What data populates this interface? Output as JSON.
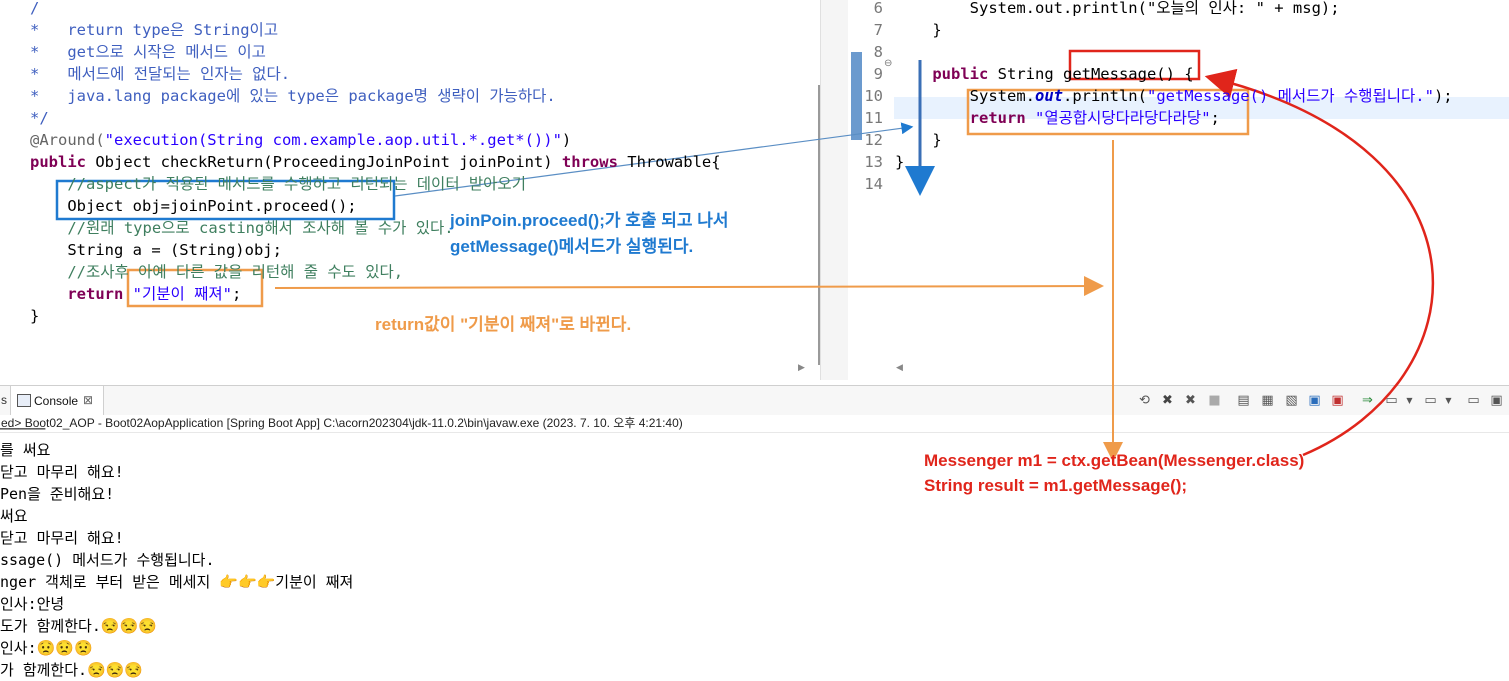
{
  "left_code": {
    "lines": [
      {
        "parts": [
          {
            "t": "/",
            "c": "jd"
          }
        ]
      },
      {
        "parts": [
          {
            "t": "*   return type은 String이고",
            "c": "jd"
          }
        ]
      },
      {
        "parts": [
          {
            "t": "*   get으로 시작은 메서드 이고",
            "c": "jd"
          }
        ]
      },
      {
        "parts": [
          {
            "t": "*   메서드에 전달되는 인자는 없다.",
            "c": "jd"
          }
        ]
      },
      {
        "parts": [
          {
            "t": "*   java.lang package에 있는 type은 package명 생략이 가능하다.",
            "c": "jd"
          }
        ]
      },
      {
        "parts": [
          {
            "t": "*/",
            "c": "jd"
          }
        ]
      },
      {
        "parts": [
          {
            "t": "@Around(",
            "c": "an"
          },
          {
            "t": "\"execution(String com.example.aop.util.*.get*())\"",
            "c": "st"
          },
          {
            "t": ")",
            "c": ""
          }
        ]
      },
      {
        "parts": [
          {
            "t": "public",
            "c": "kw"
          },
          {
            "t": " Object checkReturn(ProceedingJoinPoint joinPoint) ",
            "c": ""
          },
          {
            "t": "throws",
            "c": "kw"
          },
          {
            "t": " Throwable{",
            "c": ""
          }
        ]
      },
      {
        "parts": [
          {
            "t": "    //aspect가 적용된 메서드를 수행하고 리턴되는 데이터 받아오기",
            "c": "cm"
          }
        ]
      },
      {
        "parts": [
          {
            "t": "    Object obj=joinPoint.proceed();",
            "c": ""
          }
        ]
      },
      {
        "parts": [
          {
            "t": "    //원래 type으로 casting해서 조사해 볼 수가 있다.",
            "c": "cm"
          }
        ]
      },
      {
        "parts": [
          {
            "t": "    String a = (String)obj;",
            "c": ""
          }
        ]
      },
      {
        "parts": [
          {
            "t": "    //조사후 아예 다른 값을 리턴해 줄 수도 있다,",
            "c": "cm"
          }
        ]
      },
      {
        "parts": [
          {
            "t": "    return",
            "c": "kw"
          },
          {
            "t": " ",
            "c": ""
          },
          {
            "t": "\"기분이 째져\"",
            "c": "st"
          },
          {
            "t": ";",
            "c": ""
          }
        ]
      },
      {
        "parts": [
          {
            "t": "}",
            "c": ""
          }
        ]
      }
    ]
  },
  "right_code": {
    "line_numbers": [
      "6",
      "7",
      "8",
      "9",
      "10",
      "11",
      "12",
      "13",
      "14"
    ],
    "lines": [
      {
        "parts": [
          {
            "t": "        System.out.println(\"오늘의 인사: \" + msg);",
            "c": ""
          }
        ]
      },
      {
        "parts": [
          {
            "t": "    }",
            "c": ""
          }
        ]
      },
      {
        "parts": [
          {
            "t": "",
            "c": ""
          }
        ]
      },
      {
        "parts": [
          {
            "t": "    public",
            "c": "kw"
          },
          {
            "t": " String getMessage() {",
            "c": ""
          }
        ]
      },
      {
        "parts": [
          {
            "t": "        System.",
            "c": ""
          },
          {
            "t": "out",
            "c": "it"
          },
          {
            "t": ".println(",
            "c": ""
          },
          {
            "t": "\"getMessage() 메서드가 수행됩니다.\"",
            "c": "st"
          },
          {
            "t": ");",
            "c": ""
          }
        ]
      },
      {
        "parts": [
          {
            "t": "        return",
            "c": "kw"
          },
          {
            "t": " ",
            "c": ""
          },
          {
            "t": "\"열공합시당다라당다라당\"",
            "c": "st"
          },
          {
            "t": ";",
            "c": ""
          }
        ]
      },
      {
        "parts": [
          {
            "t": "    }",
            "c": ""
          }
        ]
      },
      {
        "parts": [
          {
            "t": "}",
            "c": ""
          }
        ]
      },
      {
        "parts": [
          {
            "t": "",
            "c": ""
          }
        ]
      }
    ]
  },
  "console": {
    "tab_label": "Console",
    "tab_close": "⊠",
    "left_tab_fragment": "s",
    "header": "ed> Boot02_AOP - Boot02AopApplication [Spring Boot App] C:\\acorn202304\\jdk-11.0.2\\bin\\javaw.exe (2023. 7. 10. 오후 4:21:40)",
    "lines": [
      "를 써요",
      "닫고 마무리 해요!",
      "Pen을 준비해요!",
      "써요",
      "닫고 마무리 해요!",
      "ssage() 메서드가 수행됩니다.",
      "nger 객체로 부터 받은 메세지 👉👉👉기분이 째져",
      "인사:안녕",
      "도가 함께한다.😒😒😒",
      "인사:😟😟😟",
      "가 함께한다.😒😒😒"
    ]
  },
  "annotations": {
    "blue_line1": "joinPoin.proceed();가 호출 되고 나서",
    "blue_line2": "getMessage()메서드가 실행된다.",
    "orange_text": "return값이 \"기분이 째져\"로 바뀐다.",
    "red_line1": "Messenger m1 = ctx.getBean(Messenger.class)",
    "red_line2": "String result = m1.getMessage();"
  },
  "colors": {
    "blue": "#1f7ad0",
    "orange": "#ef9b4a",
    "red": "#e0251b"
  }
}
